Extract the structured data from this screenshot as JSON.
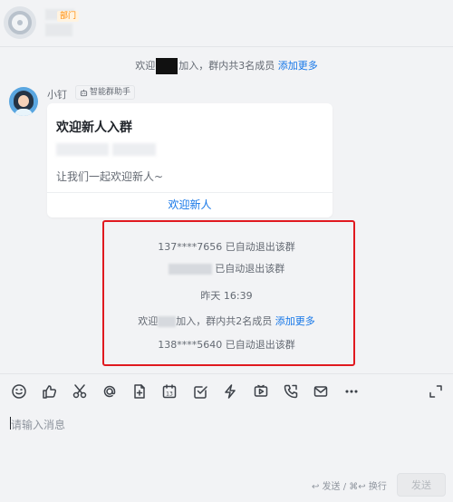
{
  "header": {
    "dept_tag": "部门"
  },
  "system_messages": {
    "join_1": {
      "prefix": "欢迎",
      "middle": "加入，群内共3名成员",
      "link": "添加更多"
    }
  },
  "bot": {
    "name": "小钉",
    "tag": "智能群助手",
    "card": {
      "title": "欢迎新人入群",
      "text": "让我们一起欢迎新人~",
      "button": "欢迎新人"
    }
  },
  "events": {
    "exit_1": "137****7656 已自动退出该群",
    "exit_2": "已自动退出该群",
    "time": "昨天 16:39",
    "join_2": {
      "prefix": "欢迎",
      "middle": "加入，群内共2名成员",
      "link": "添加更多"
    },
    "exit_3": "138****5640 已自动退出该群"
  },
  "composer": {
    "placeholder": "请输入消息",
    "hint": "↩ 发送 / ⌘↩ 换行",
    "send": "发送"
  },
  "toolbar": {
    "icons": [
      "emoji-icon",
      "thumbs-up-icon",
      "scissors-icon",
      "at-icon",
      "add-doc-icon",
      "calendar-icon",
      "checkbox-icon",
      "lightning-icon",
      "video-icon",
      "phone-icon",
      "mail-icon",
      "more-icon",
      "expand-icon"
    ],
    "calendar_day": "13"
  },
  "colors": {
    "accent": "#1476e8",
    "highlight_border": "#e0191f",
    "dept_tag": "#ff8800"
  }
}
